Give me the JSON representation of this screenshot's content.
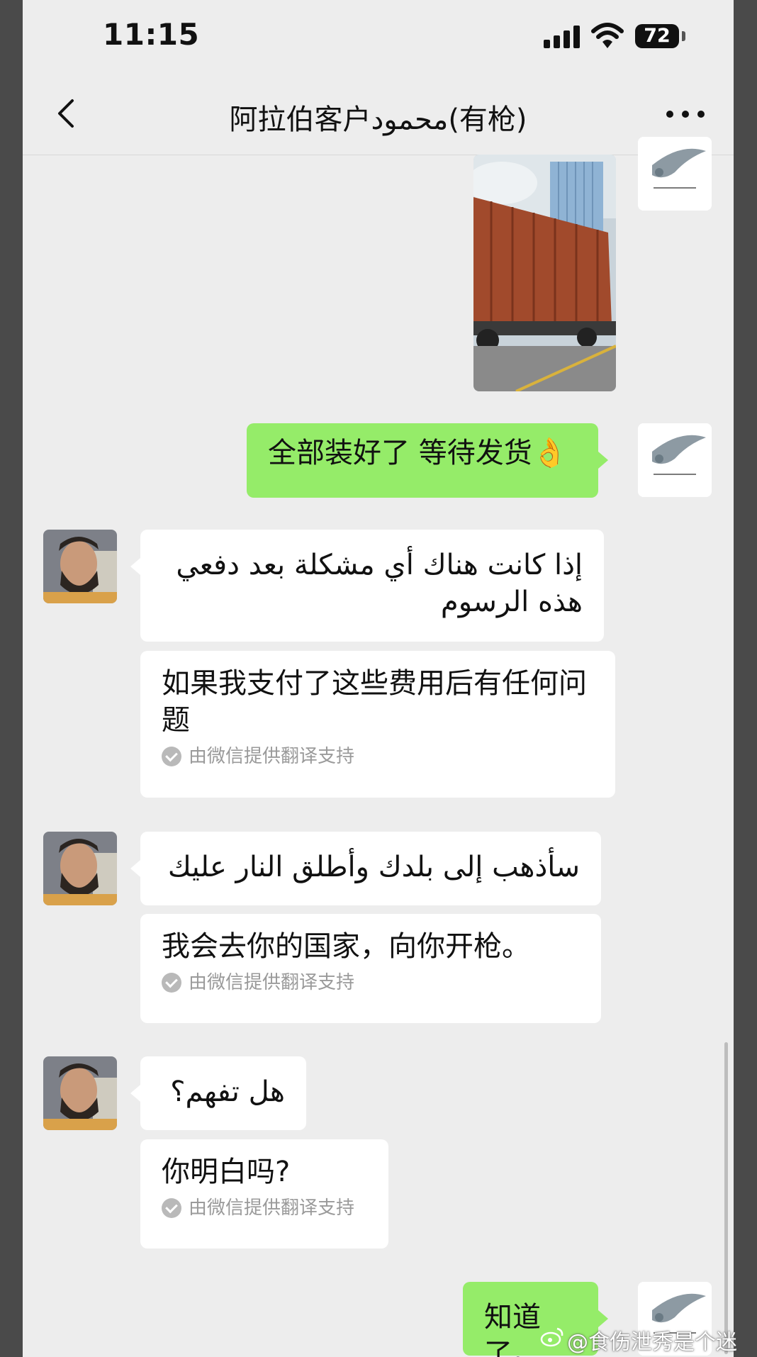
{
  "status_bar": {
    "time": "11:15",
    "battery": "72"
  },
  "nav": {
    "title": "阿拉伯客户محمود(有枪)"
  },
  "colors": {
    "outgoing_bubble": "#95ec69",
    "incoming_bubble": "#ffffff",
    "chat_background": "#ededed"
  },
  "messages": [
    {
      "sender": "me",
      "type": "image",
      "image": "truck-photo"
    },
    {
      "sender": "me",
      "type": "text",
      "text": "全部装好了 等待发货👌"
    },
    {
      "sender": "contact",
      "type": "text",
      "text": "إذا كانت هناك أي مشكلة بعد دفعي هذه الرسوم"
    },
    {
      "sender": "contact",
      "type": "translation",
      "text": "如果我支付了这些费用后有任何问题",
      "note": "由微信提供翻译支持"
    },
    {
      "sender": "contact",
      "type": "text",
      "text": "سأذهب إلى بلدك وأطلق النار عليك"
    },
    {
      "sender": "contact",
      "type": "translation",
      "text": "我会去你的国家，向你开枪。",
      "note": "由微信提供翻译支持"
    },
    {
      "sender": "contact",
      "type": "text",
      "text": "هل تفهم؟"
    },
    {
      "sender": "contact",
      "type": "translation",
      "text": "你明白吗?",
      "note": "由微信提供翻译支持"
    },
    {
      "sender": "me",
      "type": "text",
      "text": "知道了。"
    }
  ],
  "watermark": "@食伤泄秀是个迷"
}
